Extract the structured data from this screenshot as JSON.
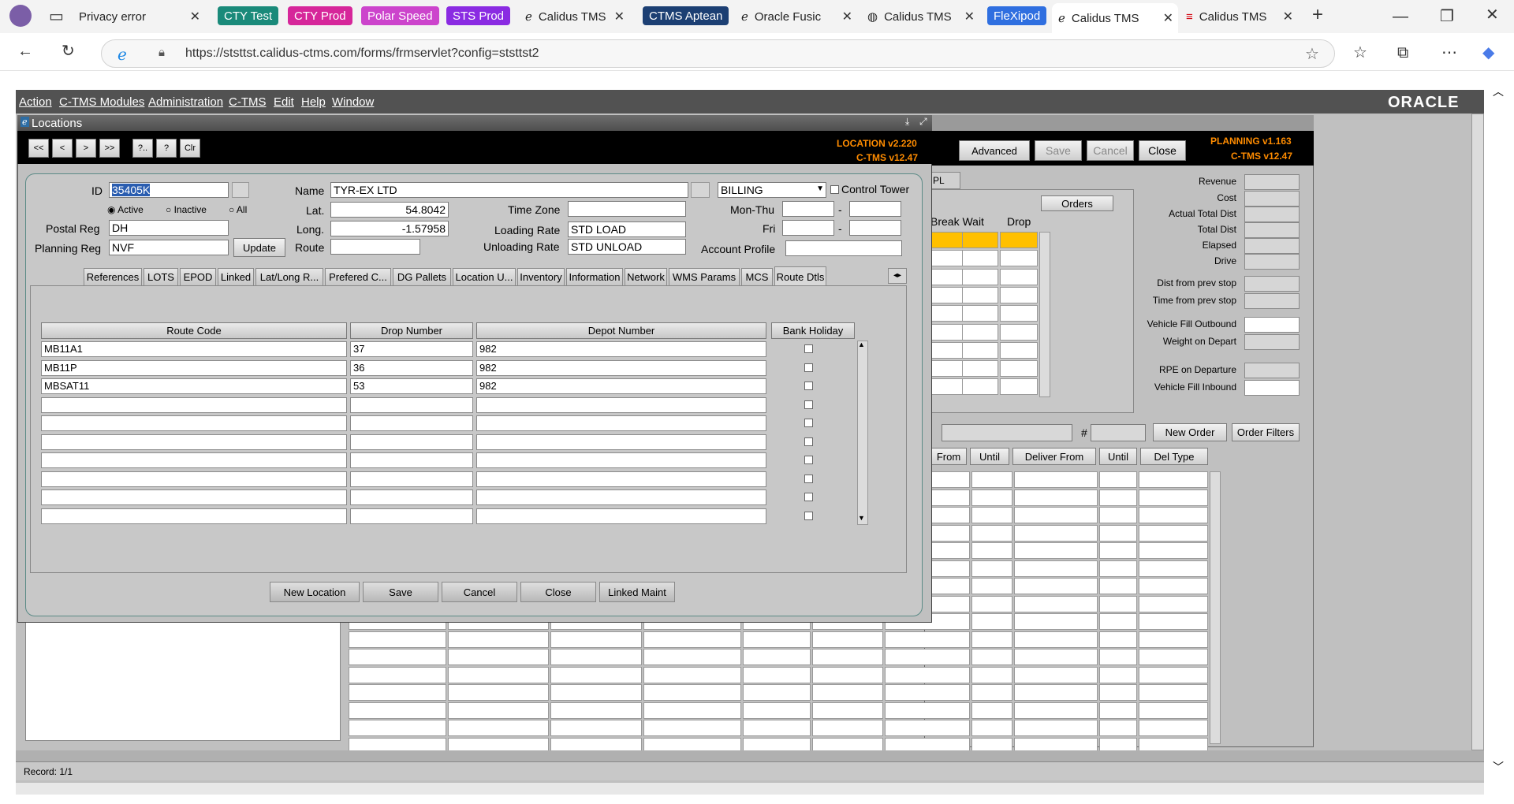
{
  "browser": {
    "tabs": [
      {
        "label": "Privacy error"
      },
      {
        "label": "CTY Test",
        "color": "#1a8a7a"
      },
      {
        "label": "CTY Prod",
        "color": "#d6269a"
      },
      {
        "label": "Polar Speed",
        "color": "#cc44cc"
      },
      {
        "label": "STS Prod",
        "color": "#8a2be2"
      },
      {
        "label": "Calidus TMS"
      },
      {
        "label": "CTMS Aptean",
        "color": "#1c3f73"
      },
      {
        "label": "Oracle Fusic"
      },
      {
        "label": "Calidus TMS"
      },
      {
        "label": "FleXipod",
        "color": "#2f6fe0"
      },
      {
        "label": "Calidus TMS"
      },
      {
        "label": "Calidus TMS"
      }
    ],
    "url": "https://ststtst.calidus-ctms.com/forms/frmservlet?config=ststtst2"
  },
  "app": {
    "menu": [
      "Action",
      "C-TMS Modules",
      "Administration",
      "C-TMS",
      "Edit",
      "Help",
      "Window"
    ],
    "brand": "ORACLE",
    "status": "Record: 1/1"
  },
  "planning": {
    "version_line1": "PLANNING v1.163",
    "version_line2": "C-TMS v12.47",
    "buttons": {
      "advanced": "Advanced",
      "save": "Save",
      "cancel": "Cancel",
      "close": "Close"
    },
    "tab_fragment": "PL",
    "orders_button": "Orders",
    "col_headers": [
      "Break Wait",
      "Drop"
    ],
    "right_labels": [
      "Revenue",
      "Cost",
      "Actual Total Dist",
      "Total Dist",
      "Elapsed",
      "Drive",
      "Dist from prev stop",
      "Time from prev stop",
      "Vehicle Fill Outbound",
      "Weight on Depart",
      "RPE on Departure",
      "Vehicle Fill Inbound"
    ],
    "hash": "#",
    "new_order": "New Order",
    "order_filters": "Order Filters",
    "order_headers": [
      "From",
      "Until",
      "Deliver From",
      "Until",
      "Del Type"
    ]
  },
  "locations": {
    "title": "Locations",
    "version_line1": "LOCATION v2.220",
    "version_line2": "C-TMS v12.47",
    "nav_buttons": [
      "<<",
      "<",
      ">",
      ">>",
      "?..",
      "?",
      "Clr"
    ],
    "id_label": "ID",
    "id_value": "35405K",
    "status_options": [
      "Active",
      "Inactive",
      "All"
    ],
    "postal_reg_label": "Postal Reg",
    "postal_reg_value": "DH",
    "planning_reg_label": "Planning Reg",
    "planning_reg_value": "NVF",
    "update_button": "Update",
    "name_label": "Name",
    "name_value": "TYR-EX LTD",
    "billing_value": "BILLING",
    "control_tower_label": "Control Tower",
    "lat_label": "Lat.",
    "lat_value": "54.8042",
    "long_label": "Long.",
    "long_value": "-1.57958",
    "route_label": "Route",
    "route_value": "",
    "time_zone_label": "Time Zone",
    "loading_rate_label": "Loading Rate",
    "loading_rate_value": "STD LOAD",
    "unloading_rate_label": "Unloading Rate",
    "unloading_rate_value": "STD UNLOAD",
    "mon_thu_label": "Mon-Thu",
    "fri_label": "Fri",
    "dash": "-",
    "account_profile_label": "Account Profile",
    "tabs": [
      "References",
      "LOTS",
      "EPOD",
      "Linked",
      "Lat/Long R...",
      "Prefered C...",
      "DG Pallets",
      "Location U...",
      "Inventory",
      "Information",
      "Network",
      "WMS Params",
      "MCS",
      "Route Dtls"
    ],
    "table": {
      "headers": [
        "Route Code",
        "Drop Number",
        "Depot Number",
        "Bank Holiday"
      ],
      "rows": [
        {
          "route_code": "MB11A1",
          "drop_number": "37",
          "depot_number": "982"
        },
        {
          "route_code": "MB11P",
          "drop_number": "36",
          "depot_number": "982"
        },
        {
          "route_code": "MBSAT11",
          "drop_number": "53",
          "depot_number": "982"
        },
        {
          "route_code": "",
          "drop_number": "",
          "depot_number": ""
        },
        {
          "route_code": "",
          "drop_number": "",
          "depot_number": ""
        },
        {
          "route_code": "",
          "drop_number": "",
          "depot_number": ""
        },
        {
          "route_code": "",
          "drop_number": "",
          "depot_number": ""
        },
        {
          "route_code": "",
          "drop_number": "",
          "depot_number": ""
        },
        {
          "route_code": "",
          "drop_number": "",
          "depot_number": ""
        },
        {
          "route_code": "",
          "drop_number": "",
          "depot_number": ""
        }
      ]
    },
    "bottom_buttons": [
      "New Location",
      "Save",
      "Cancel",
      "Close",
      "Linked Maint"
    ]
  },
  "colors": {
    "accent": "#ff8c00",
    "highlight_row": "#ffc000",
    "titlebar": "#000000"
  }
}
